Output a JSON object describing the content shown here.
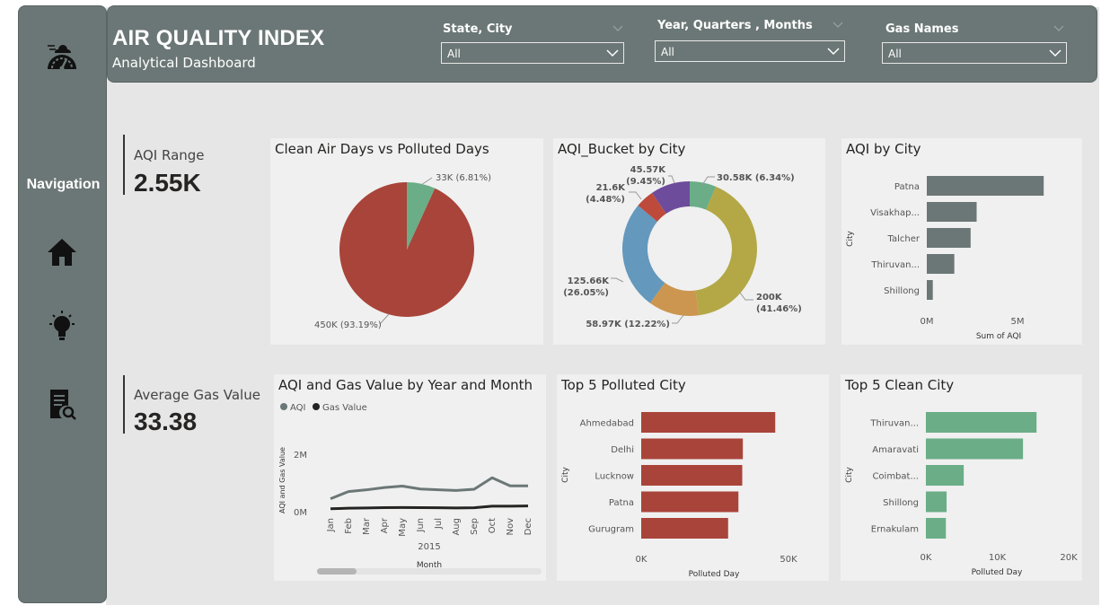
{
  "header": {
    "title": "AIR QUALITY INDEX",
    "subtitle": "Analytical Dashboard"
  },
  "sidebar": {
    "label": "Navigation",
    "items": [
      {
        "icon": "air-quality-gauge-icon"
      },
      {
        "icon": "home-icon"
      },
      {
        "icon": "lightbulb-icon"
      },
      {
        "icon": "report-search-icon"
      }
    ]
  },
  "slicers": [
    {
      "title": "State, City",
      "value": "All"
    },
    {
      "title": "Year, Quarters , Months",
      "value": "All"
    },
    {
      "title": "Gas Names",
      "value": "All"
    }
  ],
  "kpis": [
    {
      "label": "AQI Range",
      "value": "2.55K"
    },
    {
      "label": "Average Gas Value",
      "value": "33.38"
    }
  ],
  "colors": {
    "sidebar": "#6b7776",
    "polluted": "#a9443a",
    "clean": "#6aad87",
    "grey_bar": "#6b7776"
  },
  "chart_data": [
    {
      "id": "clean-vs-polluted",
      "type": "pie",
      "title": "Clean Air Days vs Polluted Days",
      "slices": [
        {
          "value": 450000,
          "label": "450K (93.19%)",
          "color": "#a9443a"
        },
        {
          "value": 33000,
          "label": "33K (6.81%)",
          "color": "#6aad87"
        }
      ]
    },
    {
      "id": "aqi-bucket-by-city",
      "type": "pie",
      "donut": true,
      "title": "AQI_Bucket by City",
      "slices": [
        {
          "value": 30580,
          "label": "30.58K (6.34%)",
          "color": "#6aad87"
        },
        {
          "value": 200000,
          "label": "200K (41.46%)",
          "color": "#b3a845"
        },
        {
          "value": 58970,
          "label": "58.97K (12.22%)",
          "color": "#cc9650"
        },
        {
          "value": 125660,
          "label": "125.66K (26.05%)",
          "color": "#6498bd"
        },
        {
          "value": 21600,
          "label": "21.6K (4.48%)",
          "color": "#bd4a3b"
        },
        {
          "value": 45570,
          "label": "45.57K (9.45%)",
          "color": "#6e4c9c"
        }
      ]
    },
    {
      "id": "aqi-by-city",
      "type": "bar",
      "orientation": "horizontal",
      "title": "AQI by City",
      "categories": [
        "Patna",
        "Visakhap...",
        "Talcher",
        "Thiruvan...",
        "Shillong"
      ],
      "values": [
        6800000,
        2900000,
        2550000,
        1600000,
        350000
      ],
      "xlabel": "Sum of AQI",
      "ylabel": "City",
      "xticks": [
        "0M",
        "5M"
      ],
      "xlim": [
        0,
        7000000
      ],
      "color": "#6b7776"
    },
    {
      "id": "aqi-gas-by-month",
      "type": "line",
      "title": "AQI and Gas Value by Year and Month",
      "x": [
        "Jan",
        "Feb",
        "Mar",
        "Apr",
        "May",
        "Jun",
        "Jul",
        "Aug",
        "Sep",
        "Oct",
        "Nov",
        "Dec"
      ],
      "x_group": "2015",
      "xlabel": "Month",
      "ylabel": "AQI and Gas Value",
      "yticks": [
        "2M",
        "0M"
      ],
      "ylim": [
        0,
        2000000
      ],
      "legend": "top-left",
      "series": [
        {
          "name": "AQI",
          "color": "#6b7776",
          "values": [
            450000,
            700000,
            760000,
            840000,
            890000,
            790000,
            760000,
            740000,
            780000,
            1180000,
            900000,
            900000
          ]
        },
        {
          "name": "Gas Value",
          "color": "#252423",
          "values": [
            100000,
            120000,
            130000,
            140000,
            145000,
            140000,
            135000,
            130000,
            135000,
            190000,
            190000,
            200000
          ]
        }
      ]
    },
    {
      "id": "top5-polluted",
      "type": "bar",
      "orientation": "horizontal",
      "title": "Top 5 Polluted City",
      "categories": [
        "Ahmedabad",
        "Delhi",
        "Lucknow",
        "Patna",
        "Gurugram"
      ],
      "values": [
        45500,
        34500,
        34300,
        33000,
        29500
      ],
      "xlabel": "Polluted Day",
      "ylabel": "City",
      "xticks": [
        "0K",
        "50K"
      ],
      "xlim": [
        0,
        50000
      ],
      "color": "#a9443a"
    },
    {
      "id": "top5-clean",
      "type": "bar",
      "orientation": "horizontal",
      "title": "Top 5 Clean City",
      "categories": [
        "Thiruvan...",
        "Amaravati",
        "Coimbat...",
        "Shillong",
        "Ernakulam"
      ],
      "values": [
        15500,
        13600,
        5300,
        2900,
        2800
      ],
      "xlabel": "Polluted Day",
      "ylabel": "City",
      "xticks": [
        "0K",
        "10K",
        "20K"
      ],
      "xlim": [
        0,
        20000
      ],
      "color": "#6aad87"
    }
  ]
}
